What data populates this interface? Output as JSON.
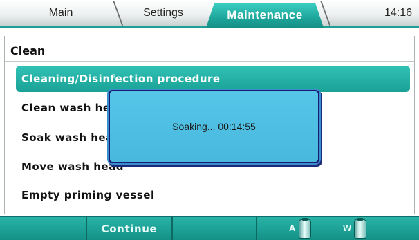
{
  "tabs": [
    {
      "label": "Main"
    },
    {
      "label": "Settings"
    },
    {
      "label": "Maintenance",
      "active": true
    }
  ],
  "clock": "14:16",
  "section": {
    "title": "Clean"
  },
  "menu": [
    {
      "label": "Cleaning/Disinfection procedure",
      "selected": true
    },
    {
      "label": "Clean wash head"
    },
    {
      "label": "Soak wash head"
    },
    {
      "label": "Move wash head"
    },
    {
      "label": "Empty priming vessel"
    }
  ],
  "dialog": {
    "text": "Soaking... 00:14:55"
  },
  "bottom": {
    "continue_label": "Continue",
    "bottle_a": "A",
    "bottle_w": "W"
  },
  "colors": {
    "accent": "#1fa79c",
    "dialog": "#4ebfe2"
  },
  "icons": [
    "bottle-a-icon",
    "bottle-w-icon"
  ]
}
